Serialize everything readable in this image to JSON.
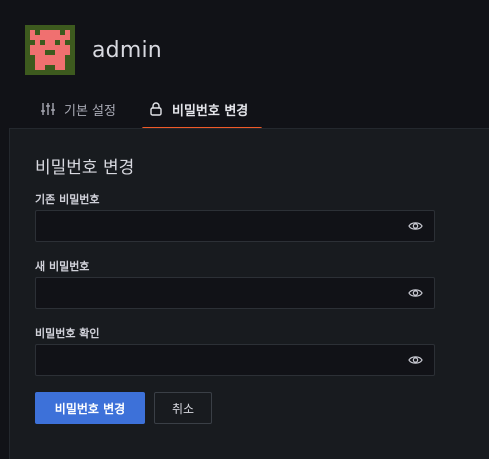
{
  "user": {
    "name": "admin",
    "avatar_icon": "pixel-avatar-icon"
  },
  "tabs": [
    {
      "label": "기본 설정",
      "icon": "sliders-icon",
      "active": false
    },
    {
      "label": "비밀번호 변경",
      "icon": "lock-icon",
      "active": true
    }
  ],
  "form": {
    "title": "비밀번호 변경",
    "fields": [
      {
        "label": "기존 비밀번호",
        "value": "",
        "icon": "eye-icon"
      },
      {
        "label": "새 비밀번호",
        "value": "",
        "icon": "eye-icon"
      },
      {
        "label": "비밀번호 확인",
        "value": "",
        "icon": "eye-icon"
      }
    ],
    "submit_label": "비밀번호 변경",
    "cancel_label": "취소"
  },
  "colors": {
    "accent": "#f05a28",
    "primary_button": "#3d71d9",
    "avatar_bg": "#3d5a1e",
    "avatar_fg": "#f07070"
  }
}
